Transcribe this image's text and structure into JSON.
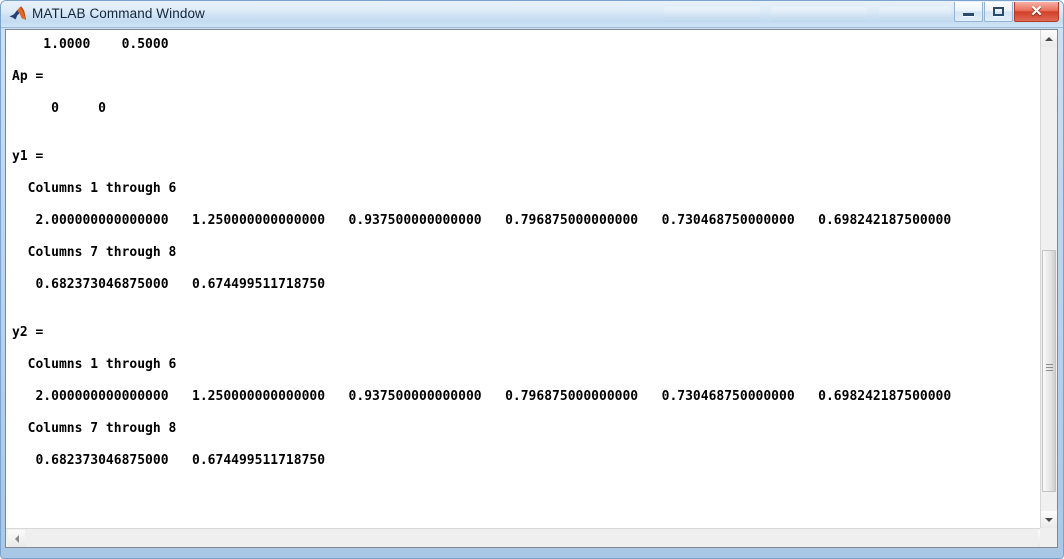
{
  "window": {
    "title": "MATLAB Command Window",
    "app_icon": "matlab-membrane-icon",
    "controls": {
      "minimize_label": "–",
      "maximize_label": "□",
      "close_label": "✕"
    }
  },
  "command_window": {
    "prompt": "»",
    "lines": [
      "    1.0000    0.5000",
      "",
      "Ap =",
      "",
      "     0     0",
      "",
      "",
      "y1 =",
      "",
      "  Columns 1 through 6",
      "",
      "   2.000000000000000   1.250000000000000   0.937500000000000   0.796875000000000   0.730468750000000   0.698242187500000",
      "",
      "  Columns 7 through 8",
      "",
      "   0.682373046875000   0.674499511718750",
      "",
      "",
      "y2 =",
      "",
      "  Columns 1 through 6",
      "",
      "   2.000000000000000   1.250000000000000   0.937500000000000   0.796875000000000   0.730468750000000   0.698242187500000",
      "",
      "  Columns 7 through 8",
      "",
      "   0.682373046875000   0.674499511718750",
      ""
    ],
    "variables": {
      "Ap": [
        [
          0,
          0
        ]
      ],
      "first_row": [
        1.0,
        0.5
      ],
      "y1": [
        2.0,
        1.25,
        0.9375,
        0.796875,
        0.73046875,
        0.6982421875,
        0.682373046875,
        0.67449951171875
      ],
      "y2": [
        2.0,
        1.25,
        0.9375,
        0.796875,
        0.73046875,
        0.6982421875,
        0.682373046875,
        0.67449951171875
      ]
    }
  },
  "scrollbars": {
    "vertical": {
      "up_arrow": "▲",
      "down_arrow": "▼"
    },
    "horizontal": {
      "left_arrow": "◀",
      "right_arrow": "▶"
    }
  },
  "colors": {
    "titlebar_top": "#e8f1fa",
    "titlebar_bottom": "#cfe4f6",
    "frame_border": "#7ba3ce",
    "close_button": "#d23f28",
    "text": "#000000",
    "background": "#ffffff"
  }
}
